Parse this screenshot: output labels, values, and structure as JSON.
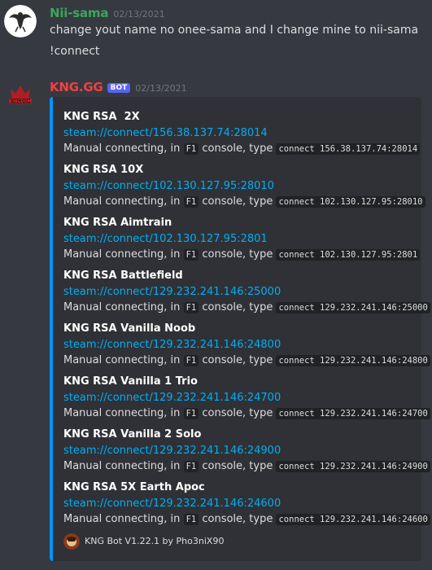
{
  "messages": [
    {
      "username": "Nii-sama",
      "username_color": "#3ba55d",
      "timestamp": "02/13/2021",
      "lines": [
        "change yout name no onee-sama and I change mine to nii-sama",
        "!connect"
      ]
    },
    {
      "username": "KNG.GG",
      "username_color": "#ed4245",
      "bot_tag": "BOT",
      "timestamp": "02/13/2021"
    }
  ],
  "embed": {
    "accent": "#0095ff",
    "manual_prefix": "Manual connecting, in",
    "manual_key": "F1",
    "manual_mid": "console, type",
    "servers": [
      {
        "title": "KNG RSA  2X",
        "link": "steam://connect/156.38.137.74:28014",
        "cmd": "connect 156.38.137.74:28014"
      },
      {
        "title": "KNG RSA 10X",
        "link": "steam://connect/102.130.127.95:28010",
        "cmd": "connect 102.130.127.95:28010"
      },
      {
        "title": "KNG RSA Aimtrain",
        "link": "steam://connect/102.130.127.95:2801",
        "cmd": "connect 102.130.127.95:2801"
      },
      {
        "title": "KNG RSA Battlefield",
        "link": "steam://connect/129.232.241.146:25000",
        "cmd": "connect 129.232.241.146:25000"
      },
      {
        "title": "KNG RSA Vanilla Noob",
        "link": "steam://connect/129.232.241.146:24800",
        "cmd": "connect 129.232.241.146:24800"
      },
      {
        "title": "KNG RSA Vanilla 1 Trio",
        "link": "steam://connect/129.232.241.146:24700",
        "cmd": "connect 129.232.241.146:24700"
      },
      {
        "title": "KNG RSA Vanilla 2 Solo",
        "link": "steam://connect/129.232.241.146:24900",
        "cmd": "connect 129.232.241.146:24900"
      },
      {
        "title": "KNG RSA 5X Earth Apoc",
        "link": "steam://connect/129.232.241.146:24600",
        "cmd": "connect 129.232.241.146:24600"
      }
    ],
    "footer": "KNG Bot V1.22.1 by Pho3niX90"
  }
}
